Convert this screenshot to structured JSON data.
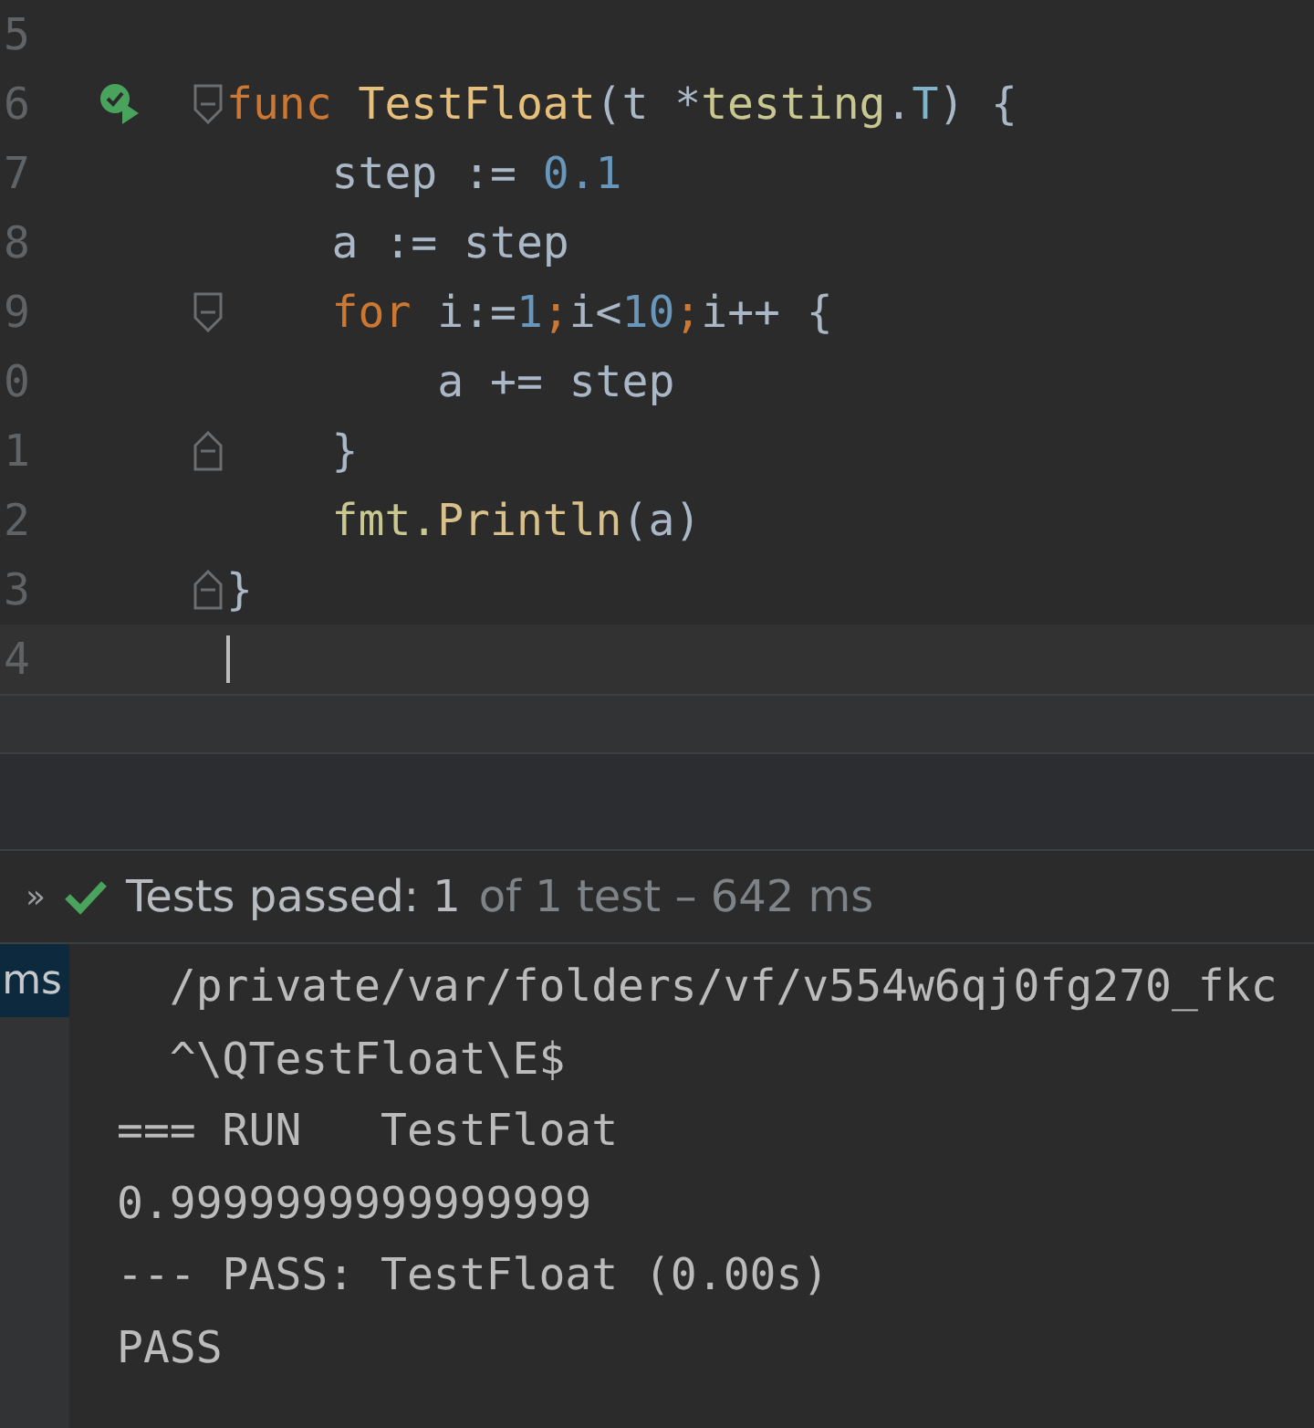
{
  "editor": {
    "lines": [
      {
        "number": "5",
        "run_marker": false,
        "fold_start": false,
        "fold_end": false,
        "current": false
      },
      {
        "number": "6",
        "run_marker": true,
        "fold_start": true,
        "fold_end": false,
        "current": false,
        "tokens": [
          {
            "kind": "keyword",
            "text": "func "
          },
          {
            "kind": "function",
            "text": "TestFloat"
          },
          {
            "kind": "plain",
            "text": "(t *"
          },
          {
            "kind": "package",
            "text": "testing"
          },
          {
            "kind": "plain",
            "text": "."
          },
          {
            "kind": "type",
            "text": "T"
          },
          {
            "kind": "plain",
            "text": ") {"
          }
        ]
      },
      {
        "number": "7",
        "run_marker": false,
        "fold_start": false,
        "fold_end": false,
        "current": false,
        "tokens": [
          {
            "kind": "plain",
            "text": "    step := "
          },
          {
            "kind": "number",
            "text": "0.1"
          }
        ]
      },
      {
        "number": "8",
        "run_marker": false,
        "fold_start": false,
        "fold_end": false,
        "current": false,
        "tokens": [
          {
            "kind": "plain",
            "text": "    a := step"
          }
        ]
      },
      {
        "number": "9",
        "run_marker": false,
        "fold_start": true,
        "fold_end": false,
        "current": false,
        "tokens": [
          {
            "kind": "keyword",
            "text": "    for "
          },
          {
            "kind": "plain",
            "text": "i:="
          },
          {
            "kind": "number",
            "text": "1"
          },
          {
            "kind": "keyword",
            "text": ";"
          },
          {
            "kind": "plain",
            "text": "i<"
          },
          {
            "kind": "number",
            "text": "10"
          },
          {
            "kind": "keyword",
            "text": ";"
          },
          {
            "kind": "plain",
            "text": "i++ {"
          }
        ]
      },
      {
        "number": "0",
        "run_marker": false,
        "fold_start": false,
        "fold_end": false,
        "current": false,
        "tokens": [
          {
            "kind": "plain",
            "text": "        a += step"
          }
        ]
      },
      {
        "number": "1",
        "run_marker": false,
        "fold_start": false,
        "fold_end": true,
        "current": false,
        "tokens": [
          {
            "kind": "plain",
            "text": "    }"
          }
        ]
      },
      {
        "number": "2",
        "run_marker": false,
        "fold_start": false,
        "fold_end": false,
        "current": false,
        "tokens": [
          {
            "kind": "package",
            "text": "    fmt."
          },
          {
            "kind": "call",
            "text": "Println"
          },
          {
            "kind": "plain",
            "text": "(a)"
          }
        ]
      },
      {
        "number": "3",
        "run_marker": false,
        "fold_start": false,
        "fold_end": true,
        "current": false,
        "tokens": [
          {
            "kind": "plain",
            "text": "}"
          }
        ]
      },
      {
        "number": "4",
        "run_marker": false,
        "fold_start": false,
        "fold_end": false,
        "current": true
      }
    ]
  },
  "test_bar": {
    "expand": "»",
    "status": "Tests passed: 1",
    "detail": "of 1 test – 642 ms"
  },
  "test_tree": {
    "items": [
      {
        "label": "ms",
        "selected": true
      }
    ]
  },
  "console": {
    "lines": [
      "  /private/var/folders/vf/v554w6qj0fg270_fkc",
      "  ^\\QTestFloat\\E$",
      "=== RUN   TestFloat",
      "0.9999999999999999",
      "--- PASS: TestFloat (0.00s)",
      "PASS"
    ]
  }
}
